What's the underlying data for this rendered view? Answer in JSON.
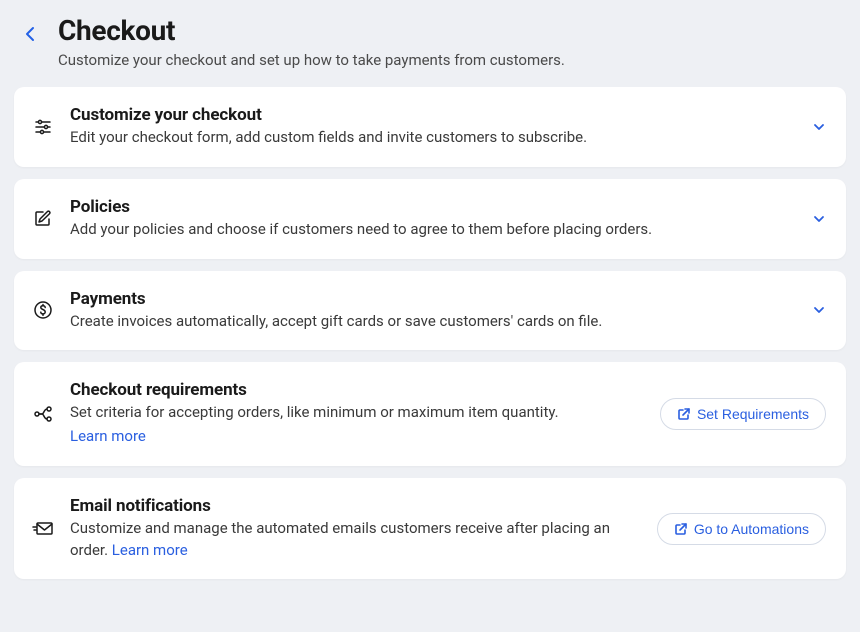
{
  "header": {
    "title": "Checkout",
    "subtitle": "Customize your checkout and set up how to take payments from customers."
  },
  "cards": {
    "customize": {
      "title": "Customize your checkout",
      "desc": "Edit your checkout form, add custom fields and invite customers to subscribe."
    },
    "policies": {
      "title": "Policies",
      "desc": "Add your policies and choose if customers need to agree to them before placing orders."
    },
    "payments": {
      "title": "Payments",
      "desc": "Create invoices automatically, accept gift cards or save customers' cards on file."
    },
    "requirements": {
      "title": "Checkout requirements",
      "desc": "Set criteria for accepting orders, like minimum or maximum item quantity.",
      "learn_more": "Learn more",
      "button": "Set Requirements"
    },
    "emails": {
      "title": "Email notifications",
      "desc": "Customize and manage the automated emails customers receive after placing an order. ",
      "learn_more": "Learn more",
      "button": "Go to Automations"
    }
  }
}
